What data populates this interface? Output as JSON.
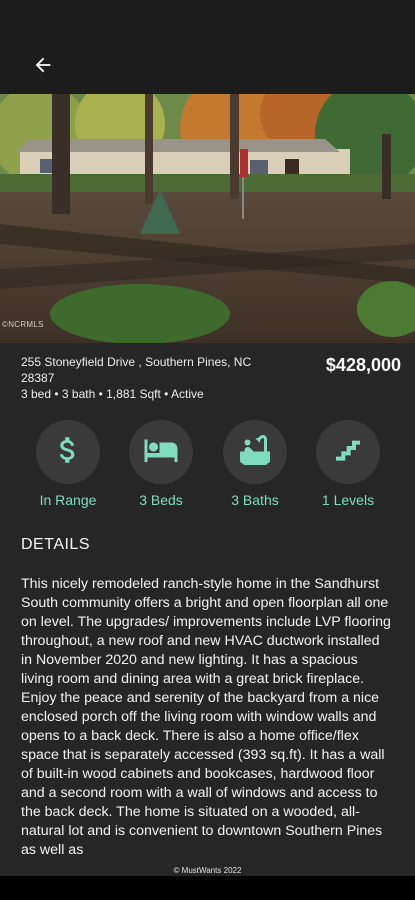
{
  "header": {
    "back_icon": "arrow-left-icon"
  },
  "photo": {
    "watermark": "©NCRMLS"
  },
  "listing": {
    "address_line1": "255  Stoneyfield  Drive , Southern Pines, NC",
    "address_line2": "28387",
    "facts": "3 bed • 3 bath • 1,881 Sqft • Active",
    "price": "$428,000"
  },
  "stats": [
    {
      "icon": "dollar-icon",
      "label": "In Range"
    },
    {
      "icon": "bed-icon",
      "label": "3 Beds"
    },
    {
      "icon": "bathtub-icon",
      "label": "3 Baths"
    },
    {
      "icon": "stairs-icon",
      "label": "1 Levels"
    }
  ],
  "details": {
    "title": "DETAILS",
    "description": "This nicely remodeled ranch-style home in the Sandhurst South community offers a bright and open floorplan all one on level. The upgrades/ improvements include LVP flooring throughout, a new roof and new HVAC ductwork installed in November 2020 and new lighting. It has a spacious living room and dining area with a great brick fireplace. Enjoy the peace and serenity of the backyard from a nice enclosed porch off the living room with window walls and opens to a back deck. There is also a home office/flex space that is separately accessed (393 sq.ft). It has a wall of built-in wood cabinets and bookcases, hardwood floor and a second room with a wall of windows and access to the back deck. The home is situated on a wooded, all-natural lot and is convenient to downtown Southern Pines as well as"
  },
  "footer": {
    "copyright": "© MustWants 2022"
  },
  "colors": {
    "accent": "#7fdcc0",
    "background": "#262626",
    "bar": "#1c1c1c"
  }
}
